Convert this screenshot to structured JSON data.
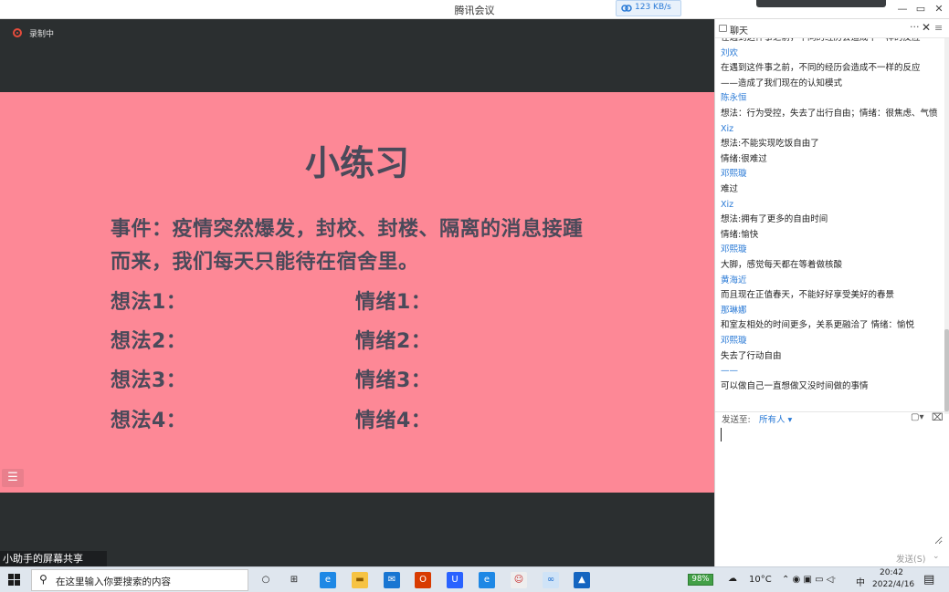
{
  "window": {
    "title": "腾讯会议",
    "network_speed": "123 KB/s",
    "controls": {
      "minimize": "—",
      "restore": "▭",
      "close": "✕"
    }
  },
  "share": {
    "recording_label": "录制中",
    "share_label": "小助手的屏幕共享",
    "menu_icon_glyph": "☰"
  },
  "slide": {
    "title": "小练习",
    "event_line1": "事件：疫情突然爆发，封校、封楼、隔离的消息接踵",
    "event_line2": "而来，我们每天只能待在宿舍里。",
    "thoughts": [
      "想法1：",
      "想法2：",
      "想法3：",
      "想法4："
    ],
    "emotions": [
      "情绪1：",
      "情绪2：",
      "情绪3：",
      "情绪4："
    ],
    "background_color": "#fd8896"
  },
  "chat": {
    "title": "聊天",
    "more_glyph": "···",
    "close_glyph": "✕",
    "side_menu_glyph": "≡",
    "messages": [
      {
        "kind": "text",
        "text": "在遇到这件事之前，不同的经历会造成不一样的反应"
      },
      {
        "kind": "name",
        "text": "刘欢"
      },
      {
        "kind": "text",
        "text": "在遇到这件事之前，不同的经历会造成不一样的反应"
      },
      {
        "kind": "text",
        "text": "——造成了我们现在的认知模式"
      },
      {
        "kind": "name",
        "text": "陈永恒"
      },
      {
        "kind": "text",
        "text": "想法：行为受控，失去了出行自由；情绪：很焦虑、气愤"
      },
      {
        "kind": "name",
        "text": "Xiz"
      },
      {
        "kind": "text",
        "text": "想法:不能实现吃饭自由了"
      },
      {
        "kind": "text",
        "text": "情绪:很难过"
      },
      {
        "kind": "name",
        "text": "邓熙璇"
      },
      {
        "kind": "text",
        "text": "难过"
      },
      {
        "kind": "name",
        "text": "Xiz"
      },
      {
        "kind": "text",
        "text": "想法:拥有了更多的自由时间"
      },
      {
        "kind": "text",
        "text": "情绪:愉快"
      },
      {
        "kind": "name",
        "text": "邓熙璇"
      },
      {
        "kind": "text",
        "text": "大脚，感觉每天都在等着做核酸"
      },
      {
        "kind": "name",
        "text": "黄海近"
      },
      {
        "kind": "text",
        "text": "而且现在正值春天，不能好好享受美好的春景"
      },
      {
        "kind": "name",
        "text": "那琳娜"
      },
      {
        "kind": "text",
        "text": "和室友相处的时间更多，关系更融洽了 情绪：愉悦"
      },
      {
        "kind": "name",
        "text": "邓熙璇"
      },
      {
        "kind": "text",
        "text": "失去了行动自由"
      },
      {
        "kind": "name",
        "text": "——"
      },
      {
        "kind": "text",
        "text": "可以做自己一直想做又没时间做的事情"
      }
    ],
    "send_to_label": "发送至:",
    "send_to_value": "所有人 ▾",
    "file_icon_glyph": "▢▾",
    "screenshot_icon_glyph": "⌧",
    "input_value": "",
    "send_button": "发送(S)",
    "send_arrow": "⌄"
  },
  "taskbar": {
    "search_placeholder": "在这里输入你要搜索的内容",
    "search_icon_glyph": "⚲",
    "apps": [
      {
        "name": "task-view",
        "glyph": "○",
        "color": "#dfe6ee",
        "fg": "#222"
      },
      {
        "name": "multitask",
        "glyph": "⊞",
        "color": "#dfe6ee",
        "fg": "#222"
      },
      {
        "name": "edge",
        "glyph": "e",
        "color": "#1e88e5",
        "fg": "#fff"
      },
      {
        "name": "explorer",
        "glyph": "▬",
        "color": "#f6c343",
        "fg": "#8a5a00"
      },
      {
        "name": "mail",
        "glyph": "✉",
        "color": "#1976d2",
        "fg": "#fff"
      },
      {
        "name": "office",
        "glyph": "O",
        "color": "#d83b01",
        "fg": "#fff"
      },
      {
        "name": "app-blue",
        "glyph": "U",
        "color": "#2962ff",
        "fg": "#fff"
      },
      {
        "name": "ie",
        "glyph": "e",
        "color": "#1e88e5",
        "fg": "#fff"
      },
      {
        "name": "app-avatar",
        "glyph": "☺",
        "color": "#eeeeee",
        "fg": "#c62828"
      },
      {
        "name": "tencent-meeting",
        "glyph": "∞",
        "color": "#cfe3f7",
        "fg": "#1e6fd0"
      },
      {
        "name": "app-mountain",
        "glyph": "▲",
        "color": "#1565c0",
        "fg": "#fff"
      }
    ],
    "battery": "98%",
    "temperature": "10°C",
    "tray_glyphs": "⌃ ◉ ▣ ▭ ◁ᐧ",
    "ime": "中",
    "time": "20:42",
    "date": "2022/4/16",
    "notification_glyph": "▤"
  }
}
